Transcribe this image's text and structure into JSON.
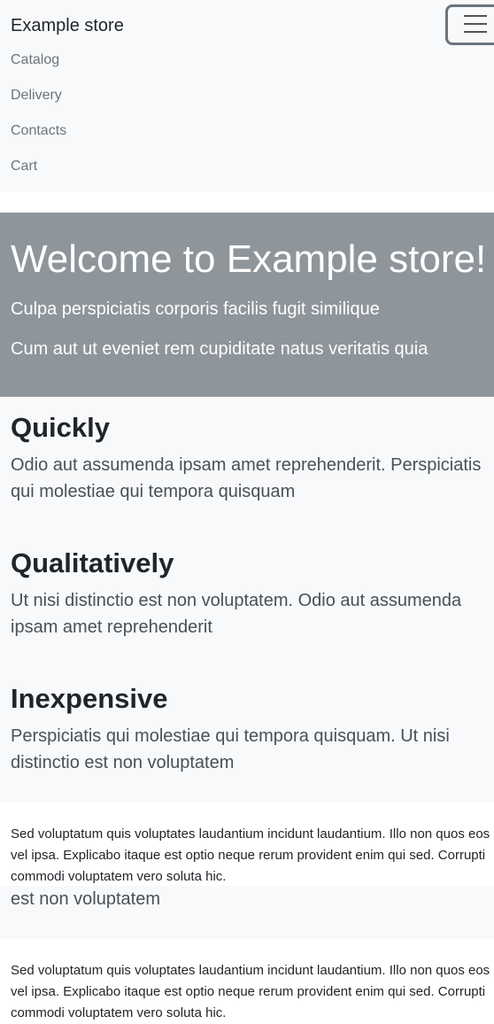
{
  "navbar": {
    "brand": "Example store",
    "toggle_icon": "hamburger-menu-icon",
    "items": [
      {
        "label": "Catalog"
      },
      {
        "label": "Delivery"
      },
      {
        "label": "Contacts"
      },
      {
        "label": "Cart"
      }
    ]
  },
  "hero": {
    "title": "Welcome to Example store!",
    "line1": "Culpa perspiciatis corporis facilis fugit similique",
    "line2": "Cum aut ut eveniet rem cupiditate natus veritatis quia"
  },
  "features": [
    {
      "title": "Quickly",
      "text": "Odio aut assumenda ipsam amet reprehenderit. Perspiciatis qui molestiae qui tempora quisquam"
    },
    {
      "title": "Qualitatively",
      "text": "Ut nisi distinctio est non voluptatem. Odio aut assumenda ipsam amet reprehenderit"
    },
    {
      "title": "Inexpensive",
      "text": "Perspiciatis qui molestiae qui tempora quisquam. Ut nisi distinctio est non voluptatem"
    }
  ],
  "footer_text": "Sed voluptatum quis voluptates laudantium incidunt laudantium. Illo non quos eos vel ipsa. Explicabo itaque est optio neque rerum provident enim qui sed. Corrupti commodi voluptatem vero soluta hic.",
  "repeated_strip": {
    "text": "est non voluptatem"
  },
  "colors": {
    "navbar_bg": "#f8f9fa",
    "hero_bg": "#8e959b",
    "text": "#212529",
    "muted": "#6c757d"
  }
}
